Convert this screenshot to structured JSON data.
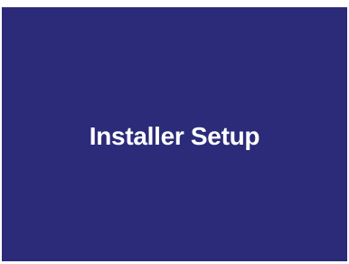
{
  "screen": {
    "title": "Installer Setup",
    "background_color": "#2b2b7a",
    "text_color": "#ffffff"
  }
}
